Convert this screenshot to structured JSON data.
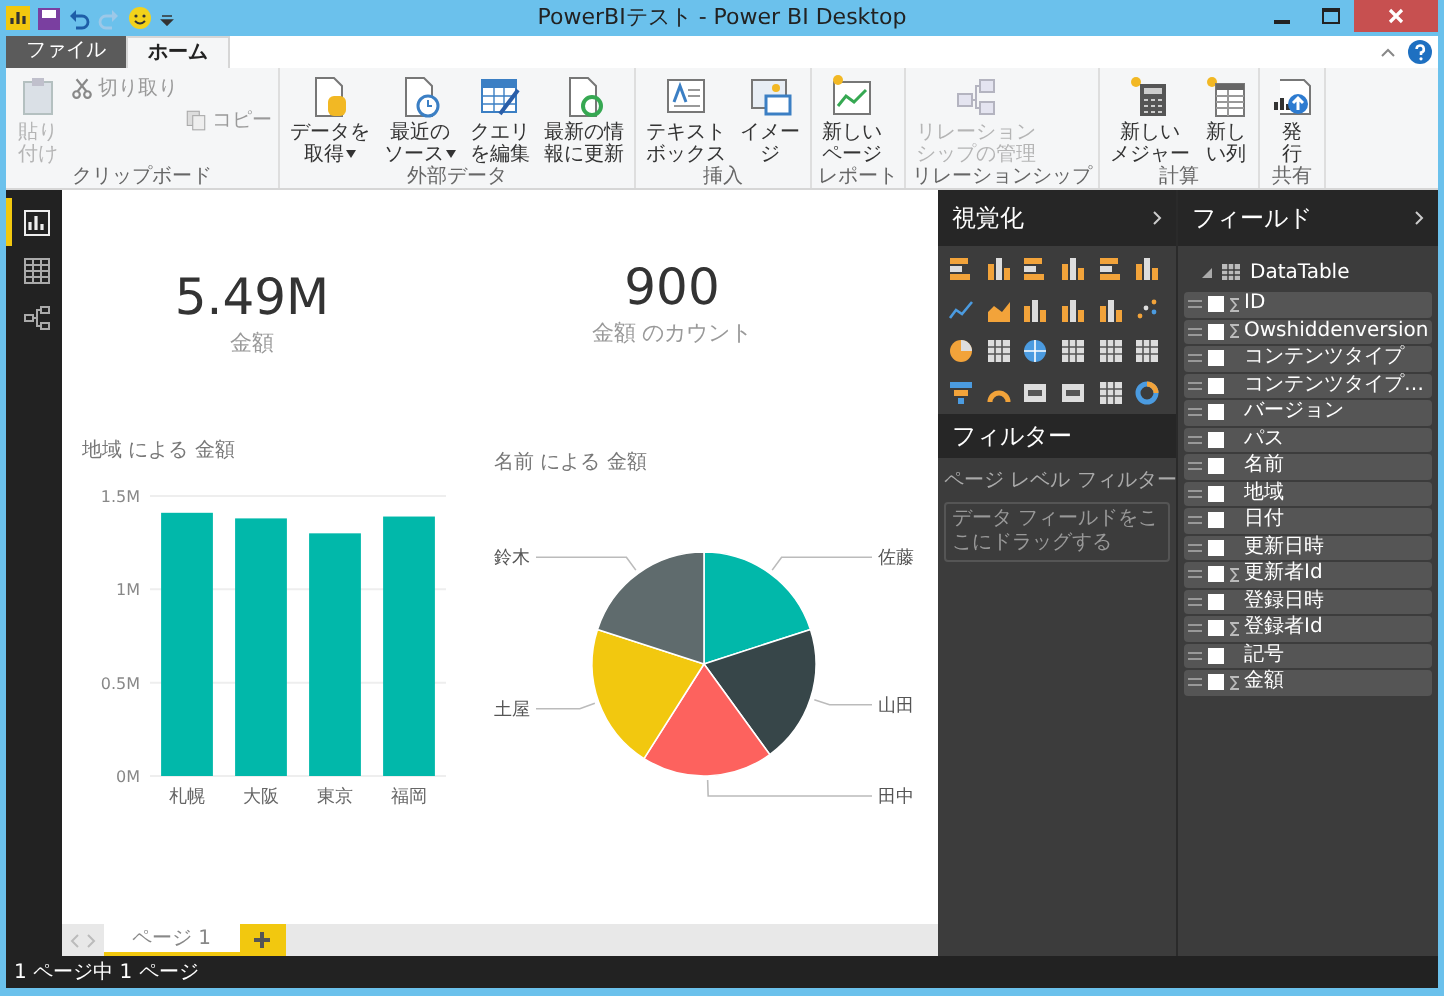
{
  "window": {
    "title": "PowerBIテスト - Power BI Desktop"
  },
  "ribbon_tabs": [
    {
      "label": "ファイル",
      "kind": "file",
      "selected": false
    },
    {
      "label": "ホーム",
      "kind": "tab",
      "selected": true
    }
  ],
  "ribbon_groups": [
    {
      "label": "クリップボード",
      "items": [
        {
          "kind": "large",
          "lines": [
            "貼り",
            "付け"
          ],
          "disabled": true,
          "dropdown": false
        },
        {
          "kind": "small",
          "lines": [
            "切り取り"
          ],
          "disabled": true
        },
        {
          "kind": "small",
          "lines": [
            "コピー"
          ],
          "disabled": true
        }
      ]
    },
    {
      "label": "外部データ",
      "items": [
        {
          "kind": "large",
          "lines": [
            "データを",
            "取得"
          ],
          "disabled": false,
          "dropdown": true
        },
        {
          "kind": "large",
          "lines": [
            "最近の",
            "ソース"
          ],
          "disabled": false,
          "dropdown": true
        },
        {
          "kind": "large",
          "lines": [
            "クエリ",
            "を編集"
          ],
          "disabled": false,
          "dropdown": false
        },
        {
          "kind": "large",
          "lines": [
            "最新の情",
            "報に更新"
          ],
          "disabled": false,
          "dropdown": false
        }
      ]
    },
    {
      "label": "挿入",
      "items": [
        {
          "kind": "large",
          "lines": [
            "テキスト",
            "ボックス"
          ],
          "disabled": false,
          "dropdown": false
        },
        {
          "kind": "large",
          "lines": [
            "イメー",
            "ジ"
          ],
          "disabled": false,
          "dropdown": false
        }
      ]
    },
    {
      "label": "レポート",
      "items": [
        {
          "kind": "large",
          "lines": [
            "新しい",
            "ページ"
          ],
          "disabled": false,
          "dropdown": false
        }
      ]
    },
    {
      "label": "リレーションシップ",
      "items": [
        {
          "kind": "large",
          "lines": [
            "リレーション",
            "シップの管理"
          ],
          "disabled": true,
          "dropdown": false
        }
      ]
    },
    {
      "label": "計算",
      "items": [
        {
          "kind": "large",
          "lines": [
            "新しい",
            "メジャー"
          ],
          "disabled": false,
          "dropdown": false
        },
        {
          "kind": "large",
          "lines": [
            "新し",
            "い列"
          ],
          "disabled": false,
          "dropdown": false
        }
      ]
    },
    {
      "label": "共有",
      "items": [
        {
          "kind": "large",
          "lines": [
            "発",
            "行"
          ],
          "disabled": false,
          "dropdown": false
        }
      ]
    }
  ],
  "views": [
    {
      "kind": "report",
      "selected": true
    },
    {
      "kind": "data",
      "selected": false
    },
    {
      "kind": "model",
      "selected": false
    }
  ],
  "cards": [
    {
      "value": "5.49M",
      "label": "金額"
    },
    {
      "value": "900",
      "label": "金額 のカウント"
    }
  ],
  "bar_chart": {
    "chart_data": {
      "type": "bar",
      "title": "地域 による 金額",
      "categories": [
        "札幌",
        "大阪",
        "東京",
        "福岡"
      ],
      "series": [
        {
          "color": "#01b8aa",
          "values": [
            1410000,
            1380000,
            1300000,
            1390000
          ]
        }
      ],
      "ylim": [
        0,
        1500000
      ],
      "yticks": [
        {
          "value": 0,
          "label": "0M"
        },
        {
          "value": 500000,
          "label": "0.5M"
        },
        {
          "value": 1000000,
          "label": "1M"
        },
        {
          "value": 1500000,
          "label": "1.5M"
        }
      ]
    }
  },
  "pie_chart": {
    "chart_data": {
      "type": "pie",
      "title": "名前 による 金額",
      "categories": [
        "佐藤",
        "山田",
        "田中",
        "土屋",
        "鈴木"
      ],
      "series": [
        {
          "values": [
            20,
            20,
            19,
            21,
            20
          ]
        }
      ],
      "colors": [
        "#01b8aa",
        "#374649",
        "#fd625e",
        "#f2c80f",
        "#5f6b6d"
      ]
    }
  },
  "pages": [
    {
      "label": "ページ 1",
      "selected": true
    }
  ],
  "visualizations": {
    "title": "視覚化"
  },
  "filters": {
    "title": "フィルター",
    "section": "ページ レベル フィルター",
    "drop_hint": "データ フィールドをここにドラッグする"
  },
  "fields": {
    "title": "フィールド",
    "table": {
      "name": "DataTable",
      "expanded": true,
      "fields": [
        {
          "name": "ID",
          "sigma": true,
          "checked": false
        },
        {
          "name": "Owshiddenversion",
          "sigma": true,
          "checked": false
        },
        {
          "name": "コンテンツタイプ",
          "sigma": false,
          "checked": false
        },
        {
          "name": "コンテンツタイプ…",
          "sigma": false,
          "checked": false
        },
        {
          "name": "バージョン",
          "sigma": false,
          "checked": false
        },
        {
          "name": "パス",
          "sigma": false,
          "checked": false
        },
        {
          "name": "名前",
          "sigma": false,
          "checked": false
        },
        {
          "name": "地域",
          "sigma": false,
          "checked": false
        },
        {
          "name": "日付",
          "sigma": false,
          "checked": false
        },
        {
          "name": "更新日時",
          "sigma": false,
          "checked": false
        },
        {
          "name": "更新者Id",
          "sigma": true,
          "checked": false
        },
        {
          "name": "登録日時",
          "sigma": false,
          "checked": false
        },
        {
          "name": "登録者Id",
          "sigma": true,
          "checked": false
        },
        {
          "name": "記号",
          "sigma": false,
          "checked": false
        },
        {
          "name": "金額",
          "sigma": true,
          "checked": false
        }
      ]
    }
  },
  "status_bar": "1 ページ中 1 ページ"
}
